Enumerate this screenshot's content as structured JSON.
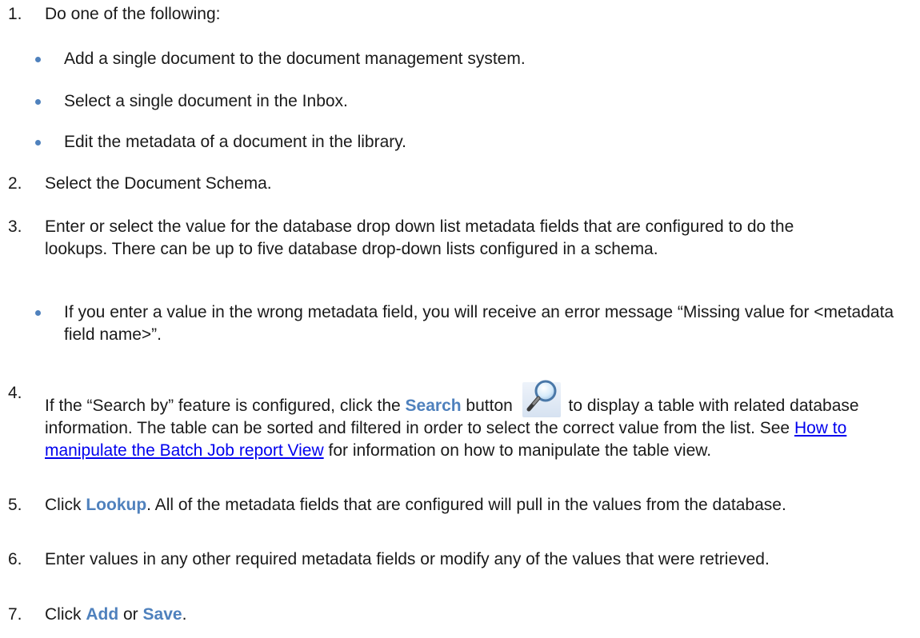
{
  "steps": [
    {
      "num": "1.",
      "text": "Do one of the following:"
    },
    {
      "num": "2.",
      "text": "Select the Document Schema."
    },
    {
      "num": "3.",
      "text": "Enter or select the value for the database drop down list metadata fields that are configured to do the lookups. There can be up to five database drop-down lists configured in a schema."
    },
    {
      "num": "4.",
      "pre": "If the “Search by” feature is configured, click the ",
      "term": "Search",
      "mid": " button ",
      "post": " to display a table with related database information. The table can be sorted and filtered in order to select the correct value from the list. See ",
      "link": "How to manipulate the Batch Job report View",
      "end": " for information on how to manipulate the table view."
    },
    {
      "num": "5.",
      "pre": "Click ",
      "term": "Lookup",
      "post": ". All of the metadata fields that are configured will pull in the values from the database."
    },
    {
      "num": "6.",
      "text": "Enter values in any other required metadata fields or modify any of the values that were retrieved."
    },
    {
      "num": "7.",
      "pre": "Click ",
      "term1": "Add",
      "mid": " or ",
      "term2": "Save",
      "end": "."
    }
  ],
  "bullets_step1": [
    "Add a single document to the document management system.",
    "Select a single document in the Inbox.",
    "Edit the metadata of a document in the library."
  ],
  "bullets_step3": [
    "If you enter a value in the wrong metadata field, you will receive an error message “Missing value for <metadata field name>”."
  ],
  "icons": {
    "search": "magnifier-icon"
  },
  "colors": {
    "text": "#1a1a1a",
    "accent": "#4f81bd",
    "link": "#0000ee"
  }
}
